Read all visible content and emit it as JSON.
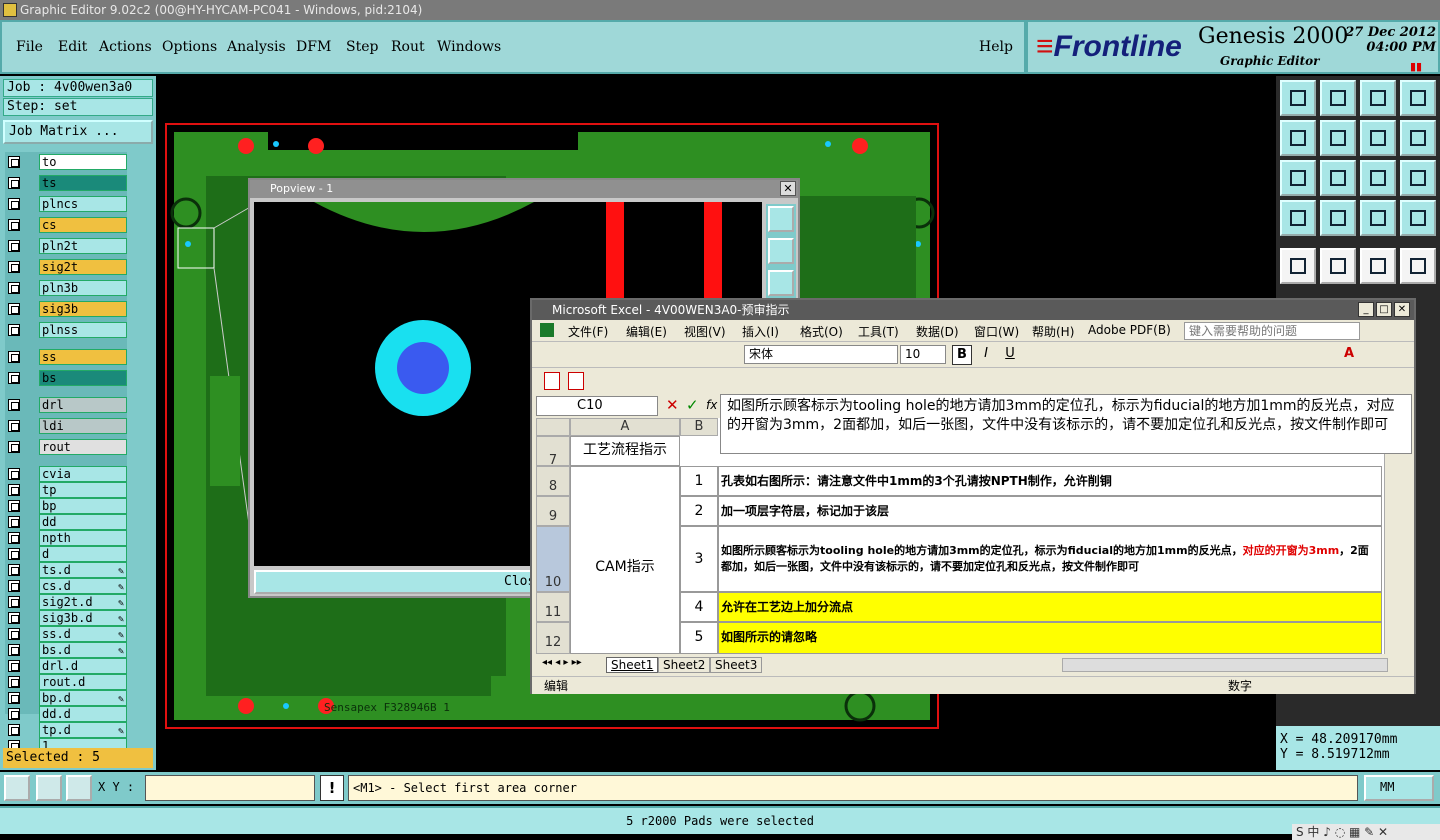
{
  "window": {
    "title": "Graphic Editor 9.02c2 (00@HY-HYCAM-PC041 - Windows, pid:2104)"
  },
  "menu": {
    "items": [
      "File",
      "Edit",
      "Actions",
      "Options",
      "Analysis",
      "DFM",
      "Step",
      "Rout",
      "Windows"
    ],
    "help": "Help"
  },
  "brand": {
    "logo": "Frontline",
    "product": "Genesis 2000",
    "subtitle": "Graphic Editor",
    "date": "27 Dec 2012",
    "time": "04:00 PM"
  },
  "job": {
    "job_label": "Job : 4v00wen3a0",
    "step_label": "Step: set",
    "matrix_label": "Job Matrix ..."
  },
  "layers": [
    {
      "name": "to",
      "color": "#ffffff"
    },
    {
      "name": "ts",
      "color": "#1a8a7a"
    },
    {
      "name": "plncs",
      "color": "#a8e6e6"
    },
    {
      "name": "cs",
      "color": "#f0c040"
    },
    {
      "name": "pln2t",
      "color": "#a8e6e6"
    },
    {
      "name": "sig2t",
      "color": "#f0c040"
    },
    {
      "name": "pln3b",
      "color": "#a8e6e6"
    },
    {
      "name": "sig3b",
      "color": "#f0c040"
    },
    {
      "name": "plnss",
      "color": "#a8e6e6"
    },
    {
      "name": "ss",
      "color": "#f0c040"
    },
    {
      "name": "bs",
      "color": "#1a8a7a"
    },
    {
      "name": "drl",
      "color": "#b8c8c8"
    },
    {
      "name": "ldi",
      "color": "#b8c8c8"
    },
    {
      "name": "rout",
      "color": "#e0e0e0"
    },
    {
      "name": "cvia",
      "color": "#a8e6e6"
    },
    {
      "name": "tp",
      "color": "#a8e6e6"
    },
    {
      "name": "bp",
      "color": "#a8e6e6"
    },
    {
      "name": "dd",
      "color": "#a8e6e6"
    },
    {
      "name": "npth",
      "color": "#a8e6e6"
    },
    {
      "name": "d",
      "color": "#a8e6e6"
    },
    {
      "name": "ts.d",
      "color": "#a8e6e6"
    },
    {
      "name": "cs.d",
      "color": "#a8e6e6"
    },
    {
      "name": "sig2t.d",
      "color": "#a8e6e6"
    },
    {
      "name": "sig3b.d",
      "color": "#a8e6e6"
    },
    {
      "name": "ss.d",
      "color": "#a8e6e6"
    },
    {
      "name": "bs.d",
      "color": "#a8e6e6"
    },
    {
      "name": "drl.d",
      "color": "#a8e6e6"
    },
    {
      "name": "rout.d",
      "color": "#a8e6e6"
    },
    {
      "name": "bp.d",
      "color": "#a8e6e6"
    },
    {
      "name": "dd.d",
      "color": "#a8e6e6"
    },
    {
      "name": "tp.d",
      "color": "#a8e6e6"
    },
    {
      "name": "1",
      "color": "#a8e6e6"
    }
  ],
  "selected": "Selected : 5",
  "coords": {
    "x": "X  =  48.209170mm",
    "y": "Y  =  8.519712mm"
  },
  "bottom": {
    "xy_label": "X Y :",
    "prompt": "<M1> - Select first area corner",
    "units": "MM",
    "bang": "!"
  },
  "status": "5 r2000 Pads were selected",
  "popview": {
    "title": "Popview - 1",
    "close": "Close"
  },
  "board": {
    "silk": "Sensapex   F328946B 1"
  },
  "excel": {
    "title": "Microsoft Excel - 4V00WEN3A0-预审指示",
    "menus": [
      "文件(F)",
      "编辑(E)",
      "视图(V)",
      "插入(I)",
      "格式(O)",
      "工具(T)",
      "数据(D)",
      "窗口(W)",
      "帮助(H)",
      "Adobe PDF(B)"
    ],
    "help_placeholder": "键入需要帮助的问题",
    "font": "宋体",
    "font_size": "10",
    "name_box": "C10",
    "formula": "如图所示顾客标示为tooling hole的地方请加3mm的定位孔，标示为fiducial的地方加1mm的反光点，对应的开窗为3mm，2面都加，如后一张图，文件中没有该标示的，请不要加定位孔和反光点，按文件制作即可",
    "col_headers": [
      "A",
      "B"
    ],
    "row_headers": [
      "7",
      "8",
      "9",
      "10",
      "11",
      "12"
    ],
    "header_cell": "工艺流程指示",
    "section_cell": "CAM指示",
    "rows": [
      {
        "num": "1",
        "text": "孔表如右图所示：请注意文件中1mm的3个孔请按NPTH制作，允许削铜"
      },
      {
        "num": "2",
        "text": "加一项层字符层，标记加于该层"
      },
      {
        "num": "3",
        "text_a": "如图所示顾客标示为tooling hole的地方请加3mm的定位孔，标示为fiducial的地方加1mm的反光点，",
        "text_red": "对应的开窗为3mm",
        "text_b": "，2面都加，如后一张图，文件中没有该标示的，请不要加定位孔和反光点，按文件制作即可"
      },
      {
        "num": "4",
        "text": "允许在工艺边上加分流点"
      },
      {
        "num": "5",
        "text": "如图所示的请忽略"
      }
    ],
    "sheets": [
      "Sheet1",
      "Sheet2",
      "Sheet3"
    ],
    "status_left": "编辑",
    "status_right": "数字"
  },
  "tray": "S 中 ♪ ◌ ▦ ✎ ✕"
}
